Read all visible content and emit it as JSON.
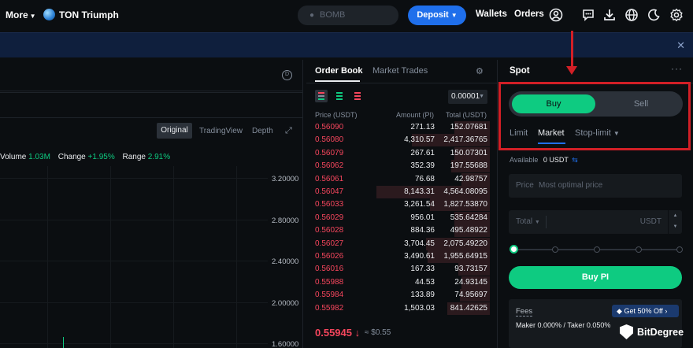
{
  "nav": {
    "more_label": "More",
    "project_name": "TON Triumph",
    "search_placeholder": "BOMB",
    "deposit_label": "Deposit",
    "wallets_label": "Wallets",
    "orders_label": "Orders"
  },
  "chart": {
    "tabs": [
      "Original",
      "TradingView",
      "Depth"
    ],
    "active_tab": "Original",
    "stats": {
      "volume_label": "Volume",
      "volume_value": "1.03M",
      "change_label": "Change",
      "change_value": "+1.95%",
      "range_label": "Range",
      "range_value": "2.91%"
    },
    "y_ticks": [
      "3.20000",
      "2.80000",
      "2.40000",
      "2.00000",
      "1.60000"
    ]
  },
  "order_book": {
    "tab_active": "Order Book",
    "tab_other": "Market Trades",
    "precision": "0.00001",
    "columns": [
      "Price (USDT)",
      "Amount (PI)",
      "Total (USDT)"
    ],
    "rows": [
      {
        "price": "0.56090",
        "amount": "271.13",
        "total": "152.07681",
        "depth": 0.25
      },
      {
        "price": "0.56080",
        "amount": "4,310.57",
        "total": "2,417.36765",
        "depth": 0.55
      },
      {
        "price": "0.56079",
        "amount": "267.61",
        "total": "150.07301",
        "depth": 0.25
      },
      {
        "price": "0.56062",
        "amount": "352.39",
        "total": "197.55688",
        "depth": 0.27
      },
      {
        "price": "0.56061",
        "amount": "76.68",
        "total": "42.98757",
        "depth": 0.2
      },
      {
        "price": "0.56047",
        "amount": "8,143.31",
        "total": "4,564.08095",
        "depth": 0.8
      },
      {
        "price": "0.56033",
        "amount": "3,261.54",
        "total": "1,827.53870",
        "depth": 0.42
      },
      {
        "price": "0.56029",
        "amount": "956.01",
        "total": "535.64284",
        "depth": 0.25
      },
      {
        "price": "0.56028",
        "amount": "884.36",
        "total": "495.48922",
        "depth": 0.25
      },
      {
        "price": "0.56027",
        "amount": "3,704.45",
        "total": "2,075.49220",
        "depth": 0.45
      },
      {
        "price": "0.56026",
        "amount": "3,490.61",
        "total": "1,955.64915",
        "depth": 0.44
      },
      {
        "price": "0.56016",
        "amount": "167.33",
        "total": "93.73157",
        "depth": 0.22
      },
      {
        "price": "0.55988",
        "amount": "44.53",
        "total": "24.93145",
        "depth": 0.2
      },
      {
        "price": "0.55984",
        "amount": "133.89",
        "total": "74.95697",
        "depth": 0.21
      },
      {
        "price": "0.55982",
        "amount": "1,503.03",
        "total": "841.42625",
        "depth": 0.3
      }
    ],
    "last_price": "0.55945 ↓",
    "last_price_usd": "≈ $0.55"
  },
  "spot": {
    "title": "Spot",
    "buy_label": "Buy",
    "sell_label": "Sell",
    "order_types": [
      "Limit",
      "Market",
      "Stop-limit"
    ],
    "active_order_type": "Market",
    "available_label": "Available",
    "available_value": "0 USDT",
    "price_label": "Price",
    "price_placeholder": "Most optimal price",
    "total_label": "Total",
    "total_unit": "USDT",
    "slider_fraction": 0,
    "buy_button_label": "Buy PI",
    "fees_label": "Fees",
    "fees_promo": "Get 50% Off",
    "fees_rate": "Maker 0.000% / Taker 0.050%"
  },
  "watermark": "BitDegree",
  "colors": {
    "accent_green": "#0ecb81",
    "ask_red": "#f6465d",
    "deposit_blue": "#1f6feb",
    "highlight_red": "#d21f26"
  }
}
